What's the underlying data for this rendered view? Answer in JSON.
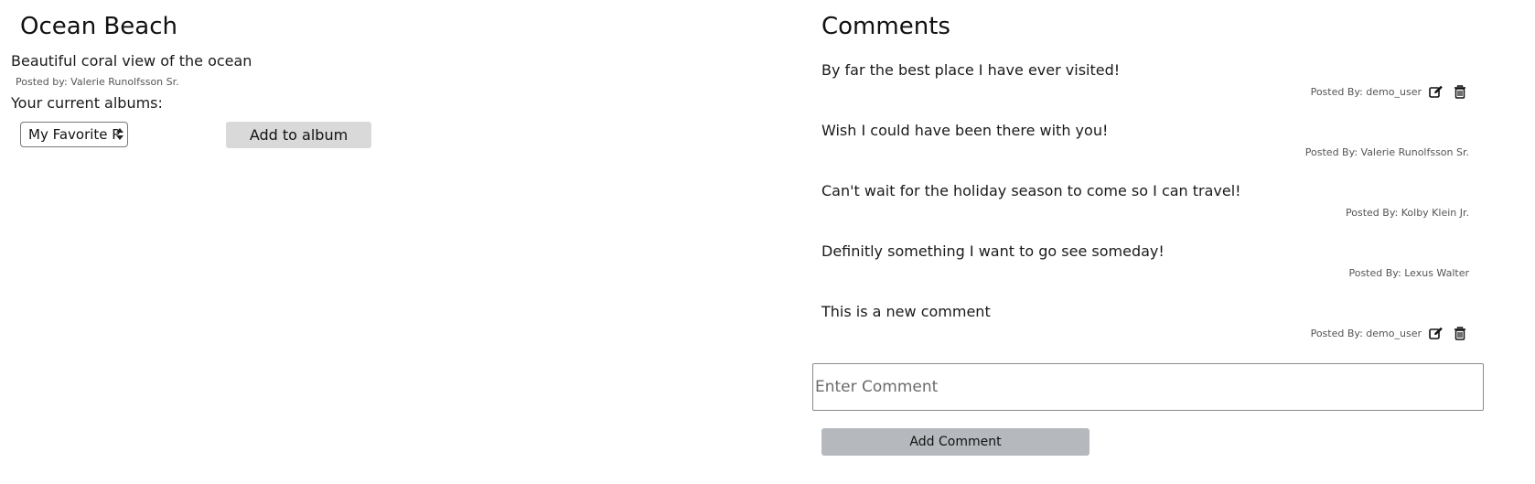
{
  "photo": {
    "title": "Ocean Beach",
    "description": "Beautiful coral view of the ocean",
    "posted_by": "Posted by: Valerie Runolfsson Sr.",
    "albums_label": "Your current albums:",
    "album_select_value": "My Favorite P",
    "add_to_album_label": "Add to album"
  },
  "comments": {
    "heading": "Comments",
    "items": [
      {
        "text": "By far the best place I have ever visited!",
        "posted_by": "Posted By: demo_user",
        "editable": true
      },
      {
        "text": "Wish I could have been there with you!",
        "posted_by": "Posted By: Valerie Runolfsson Sr.",
        "editable": false
      },
      {
        "text": "Can't wait for the holiday season to come so I can travel!",
        "posted_by": "Posted By: Kolby Klein Jr.",
        "editable": false
      },
      {
        "text": "Definitly something I want to go see someday!",
        "posted_by": "Posted By: Lexus Walter",
        "editable": false
      },
      {
        "text": "This is a new comment",
        "posted_by": "Posted By: demo_user",
        "editable": true
      }
    ],
    "input_placeholder": "Enter Comment",
    "input_value": "",
    "add_comment_label": "Add Comment"
  },
  "icons": {
    "edit": "edit-icon",
    "delete": "trash-icon"
  }
}
